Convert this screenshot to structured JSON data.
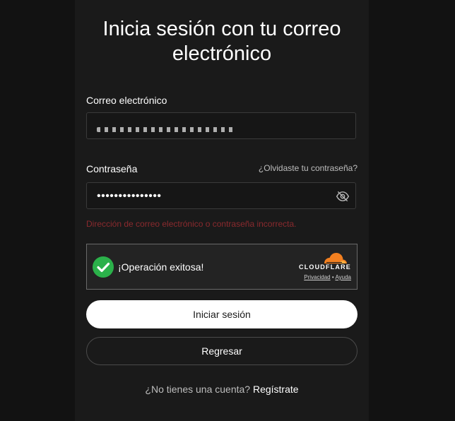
{
  "title": "Inicia sesión con tu correo electrónico",
  "email": {
    "label": "Correo electrónico",
    "value": ""
  },
  "password": {
    "label": "Contraseña",
    "forgot_link": "¿Olvidaste tu contraseña?",
    "value_masked": "•••••••••••••••",
    "toggle_icon": "eye-off-icon"
  },
  "error_message": "Dirección de correo electrónico o contraseña incorrecta.",
  "captcha": {
    "status_text": "¡Operación exitosa!",
    "brand": "CLOUDFLARE",
    "privacy_link": "Privacidad",
    "separator": "•",
    "help_link": "Ayuda",
    "success_color": "#2bb14a",
    "brand_color": "#f38020"
  },
  "buttons": {
    "login": "Iniciar sesión",
    "back": "Regresar"
  },
  "footer": {
    "prompt": "¿No tienes una cuenta?",
    "signup_link": "Regístrate"
  }
}
